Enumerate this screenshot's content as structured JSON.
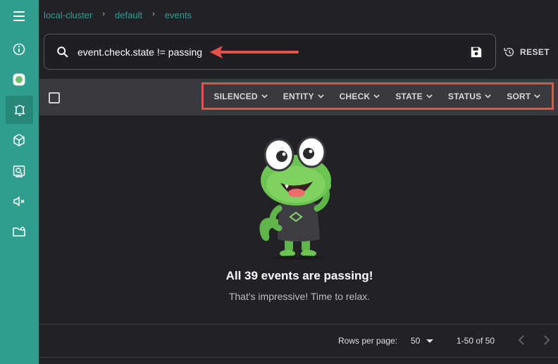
{
  "breadcrumb": {
    "cluster": "local-cluster",
    "namespace": "default",
    "page": "events",
    "separator": "›"
  },
  "sidebar": {
    "items": [
      {
        "icon": "menu-icon"
      },
      {
        "icon": "info-icon"
      },
      {
        "icon": "app-logo-icon"
      },
      {
        "icon": "bell-icon",
        "active": true
      },
      {
        "icon": "cube-icon"
      },
      {
        "icon": "entity-search-icon"
      },
      {
        "icon": "mute-icon"
      },
      {
        "icon": "folder-settings-icon"
      }
    ]
  },
  "search": {
    "value": "event.check.state != passing",
    "placeholder": "Search"
  },
  "reset_label": "RESET",
  "filters": {
    "silenced": "SILENCED",
    "entity": "ENTITY",
    "check": "CHECK",
    "state": "STATE",
    "status": "STATUS",
    "sort": "SORT"
  },
  "empty_state": {
    "title": "All 39 events are passing!",
    "subtitle": "That's impressive! Time to relax."
  },
  "pagination": {
    "rows_per_page_label": "Rows per page:",
    "rows_per_page_value": "50",
    "range": "1-50 of 50"
  },
  "colors": {
    "sidebar": "#2f9e8e",
    "accent_text": "#2aa192",
    "annotation": "#e9504a",
    "background": "#222226"
  }
}
